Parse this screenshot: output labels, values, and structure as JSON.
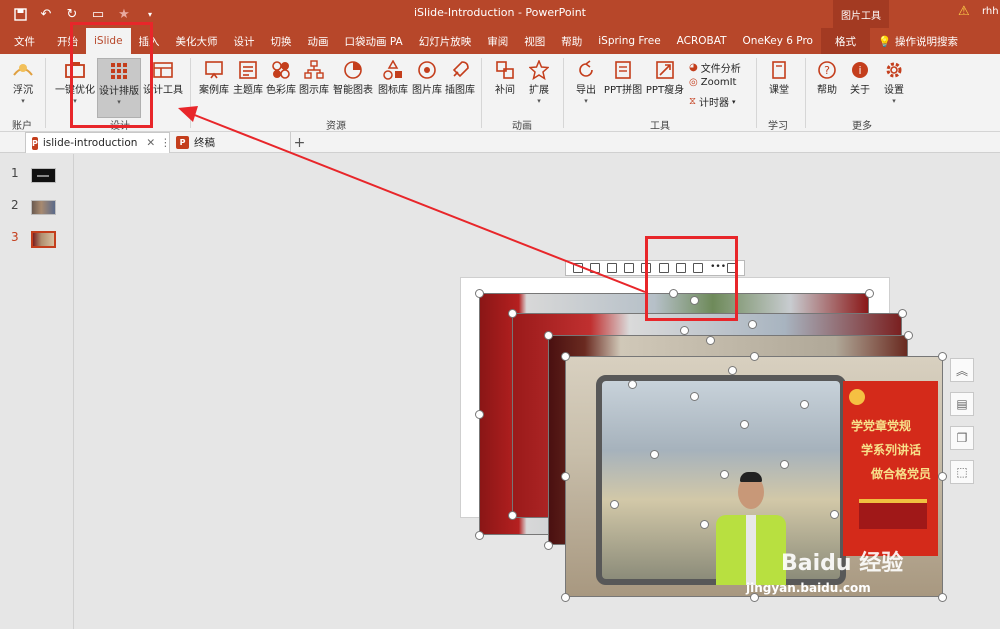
{
  "window": {
    "title": "iSlide-Introduction  -  PowerPoint",
    "context_label": "图片工具",
    "user": "rhh"
  },
  "tabs": [
    {
      "label": "文件"
    },
    {
      "label": "开始"
    },
    {
      "label": "iSlide",
      "active": true
    },
    {
      "label": "插入"
    },
    {
      "label": "美化大师"
    },
    {
      "label": "设计"
    },
    {
      "label": "切换"
    },
    {
      "label": "动画"
    },
    {
      "label": "口袋动画 PA"
    },
    {
      "label": "幻灯片放映"
    },
    {
      "label": "审阅"
    },
    {
      "label": "视图"
    },
    {
      "label": "帮助"
    },
    {
      "label": "iSpring Free"
    },
    {
      "label": "ACROBAT"
    },
    {
      "label": "OneKey 6 Pro"
    },
    {
      "label": "格式",
      "context": true
    }
  ],
  "tell_me": "操作说明搜索",
  "ribbon": {
    "account": {
      "btn": "浮沉",
      "group": "账户"
    },
    "design": {
      "group": "设计",
      "btn_optimize": "一键优化",
      "btn_layout": "设计排版",
      "btn_tools": "设计工具"
    },
    "resources": {
      "group": "资源",
      "items": [
        "案例库",
        "主题库",
        "色彩库",
        "图示库",
        "智能图表",
        "图标库",
        "图片库",
        "插图库"
      ]
    },
    "animation": {
      "group": "动画",
      "items": [
        "补间",
        "扩展"
      ]
    },
    "tools": {
      "group": "工具",
      "items": [
        "导出",
        "PPT拼图",
        "PPT瘦身"
      ],
      "small": [
        "文件分析",
        "ZoomIt",
        "计时器"
      ]
    },
    "learn": {
      "group": "学习",
      "items": [
        "课堂"
      ]
    },
    "more": {
      "group": "更多",
      "items": [
        "帮助",
        "关于",
        "设置"
      ]
    }
  },
  "doc_tabs": [
    {
      "label": "islide-introduction",
      "active": true
    },
    {
      "label": "终稿"
    }
  ],
  "slides": [
    {
      "number": "1"
    },
    {
      "number": "2"
    },
    {
      "number": "3",
      "current": true
    }
  ],
  "photo": {
    "sign_lines": [
      "学党章党规",
      "学系列讲话",
      "做合格党员"
    ]
  },
  "watermark": {
    "brand": "Baidu 经验",
    "url": "jingyan.baidu.com"
  },
  "colors": {
    "accent": "#b7472a",
    "highlight": "#e8262a",
    "ribbon_bg": "#f3f3f3",
    "canvas_bg": "#e6e6e6"
  }
}
